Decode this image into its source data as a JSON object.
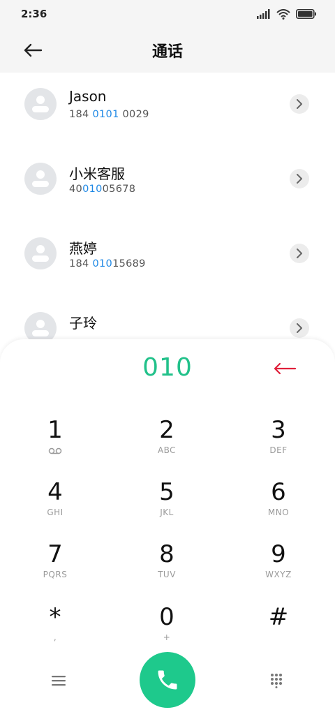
{
  "status_bar": {
    "time": "2:36",
    "icons": [
      "signal-icon",
      "wifi-icon",
      "battery-icon"
    ]
  },
  "header": {
    "title": "通话",
    "back_icon": "back-arrow-icon"
  },
  "contacts": [
    {
      "name": "Jason",
      "number_parts": [
        "184 ",
        "0101",
        " 0029"
      ]
    },
    {
      "name": "小米客服",
      "number_parts": [
        "40",
        "010",
        "05678"
      ]
    },
    {
      "name": "燕婷",
      "number_parts": [
        "184 ",
        "010",
        "15689"
      ]
    },
    {
      "name": "子玲",
      "number_parts": [
        "",
        "",
        ""
      ]
    }
  ],
  "dialpad": {
    "dialed_number": "010",
    "keys": [
      {
        "digit": "1",
        "letters": ""
      },
      {
        "digit": "2",
        "letters": "ABC"
      },
      {
        "digit": "3",
        "letters": "DEF"
      },
      {
        "digit": "4",
        "letters": "GHI"
      },
      {
        "digit": "5",
        "letters": "JKL"
      },
      {
        "digit": "6",
        "letters": "MNO"
      },
      {
        "digit": "7",
        "letters": "PQRS"
      },
      {
        "digit": "8",
        "letters": "TUV"
      },
      {
        "digit": "9",
        "letters": "WXYZ"
      },
      {
        "digit": "*",
        "letters": ","
      },
      {
        "digit": "0",
        "letters": "+"
      },
      {
        "digit": "#",
        "letters": ""
      }
    ]
  },
  "colors": {
    "accent": "#21c18a",
    "call_button": "#1ec98c",
    "highlight": "#1e88e5",
    "backspace": "#e0203b"
  }
}
